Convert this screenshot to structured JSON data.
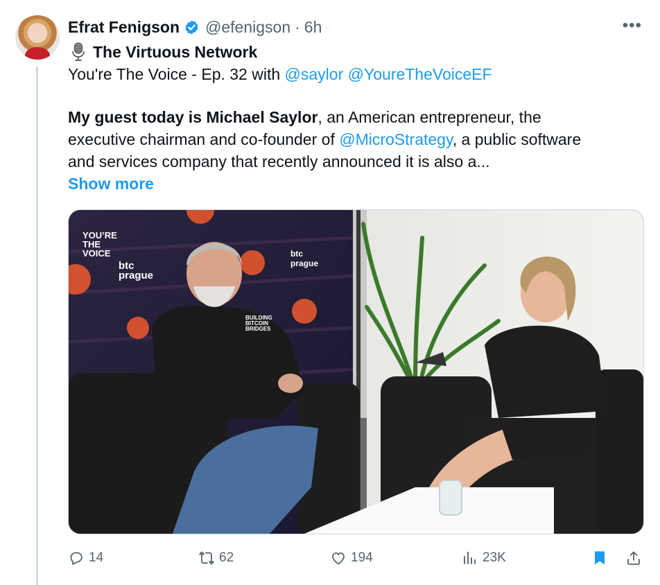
{
  "tweet": {
    "author": {
      "display_name": "Efrat Fenigson",
      "handle": "@efenigson",
      "dot": "·",
      "time": "6h"
    },
    "more_label": "•••",
    "community": "The Virtuous Network",
    "line1_prefix": "You're The Voice - Ep. 32 with ",
    "mention_saylor": "@saylor",
    "mention_ytv": "@YoureTheVoiceEF",
    "para_bold": "My guest today is Michael Saylor",
    "para_line1_rest": ", an American entrepreneur, the",
    "para_line2_prefix": "executive chairman and co-founder of ",
    "mention_microstrategy": "@MicroStrategy",
    "para_line2_rest": ", a public software",
    "para_line3": "and services company that recently announced it is also a...",
    "show_more": "Show more"
  },
  "media": {
    "logo_line1": "YOU’RE",
    "logo_line2": "THE",
    "logo_line3": "VOICE",
    "sign_btc": "btc",
    "sign_prague": "prague",
    "sign_building": "BUILDING",
    "sign_bitcoin": "BITCOIN",
    "sign_bridges": "BRIDGES"
  },
  "actions": {
    "replies": "14",
    "reposts": "62",
    "likes": "194",
    "views": "23K"
  },
  "colors": {
    "accent": "#1d9bf0",
    "secondary_text": "#536471",
    "verified": "#1d9bf0"
  },
  "icons": [
    "verified-badge-icon",
    "microphone-icon",
    "more-icon",
    "reply-icon",
    "repost-icon",
    "like-icon",
    "views-icon",
    "bookmark-icon",
    "share-icon"
  ]
}
